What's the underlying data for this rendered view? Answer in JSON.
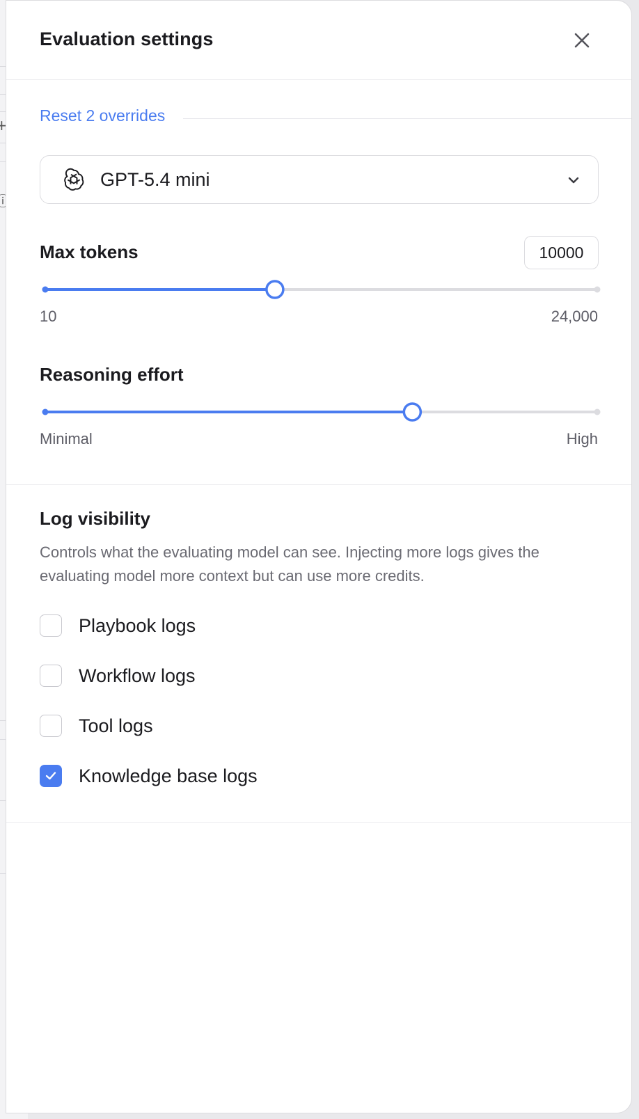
{
  "dialog": {
    "title": "Evaluation settings",
    "close_icon": "close-icon"
  },
  "overrides": {
    "reset_label": "Reset 2 overrides"
  },
  "model": {
    "selected": "GPT-5.4 mini",
    "icon": "openai-logo-icon",
    "dropdown_icon": "chevron-down-icon"
  },
  "max_tokens": {
    "label": "Max tokens",
    "value": "10000",
    "min_label": "10",
    "max_label": "24,000",
    "fraction": 0.416
  },
  "reasoning": {
    "label": "Reasoning effort",
    "min_label": "Minimal",
    "max_label": "High",
    "fraction": 0.665
  },
  "log_visibility": {
    "title": "Log visibility",
    "description": "Controls what the evaluating model can see. Injecting more logs gives the evaluating model more context but can use more credits.",
    "options": [
      {
        "label": "Playbook logs",
        "checked": false
      },
      {
        "label": "Workflow logs",
        "checked": false
      },
      {
        "label": "Tool logs",
        "checked": false
      },
      {
        "label": "Knowledge base logs",
        "checked": true
      }
    ]
  },
  "colors": {
    "accent": "#4a7cf0",
    "track": "#dcdce0",
    "text": "#1b1b1f",
    "muted": "#6a6a72"
  }
}
